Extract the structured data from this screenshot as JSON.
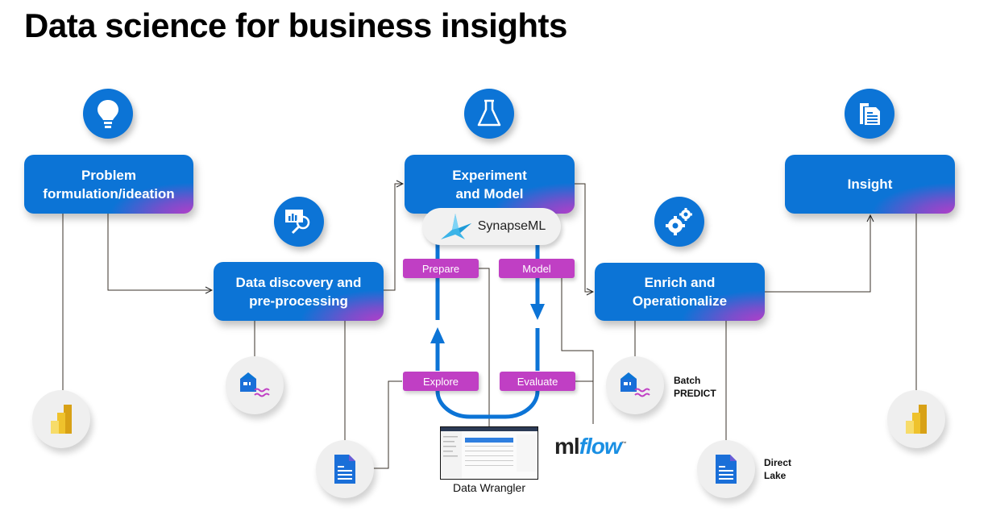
{
  "title": "Data science for business insights",
  "stages": {
    "problem": {
      "label_line1": "Problem",
      "label_line2": "formulation/ideation",
      "icon": "lightbulb-icon"
    },
    "discovery": {
      "label_line1": "Data discovery and",
      "label_line2": "pre-processing",
      "icon": "chart-search-icon"
    },
    "experiment": {
      "label_line1": "Experiment",
      "label_line2": "and Model",
      "icon": "flask-icon"
    },
    "enrich": {
      "label_line1": "Enrich and",
      "label_line2": "Operationalize",
      "icon": "gears-icon"
    },
    "insight": {
      "label_line1": "Insight",
      "label_line2": "",
      "icon": "documents-icon"
    }
  },
  "synapseml": {
    "label": "SynapseML"
  },
  "loop_tags": {
    "prepare": "Prepare",
    "model": "Model",
    "explore": "Explore",
    "evaluate": "Evaluate"
  },
  "tools": {
    "data_wrangler": "Data Wrangler",
    "mlflow_ml": "ml",
    "mlflow_flow": "flow",
    "batch_predict_line1": "Batch",
    "batch_predict_line2": "PREDICT",
    "direct_lake_line1": "Direct",
    "direct_lake_line2": "Lake"
  },
  "colors": {
    "stage_blue": "#0c74d6",
    "accent_magenta": "#c03fc4",
    "loop_blue": "#0c74d6",
    "powerbi_yellow": "#f2c811"
  }
}
